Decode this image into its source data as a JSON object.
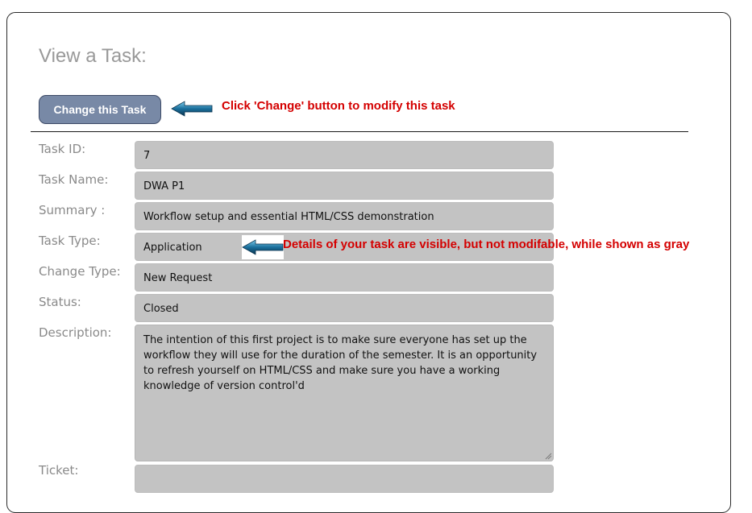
{
  "page": {
    "title": "View a Task:"
  },
  "toolbar": {
    "change_button_label": "Change this Task",
    "change_hint": "Click 'Change' button to modify this task"
  },
  "fields": {
    "task_id": {
      "label": "Task ID:",
      "value": "7"
    },
    "task_name": {
      "label": "Task Name:",
      "value": "DWA P1"
    },
    "summary": {
      "label": "Summary :",
      "value": "Workflow setup and essential HTML/CSS demonstration"
    },
    "task_type": {
      "label": "Task Type:",
      "value": "Application"
    },
    "change_type": {
      "label": "Change Type:",
      "value": "New Request"
    },
    "status": {
      "label": "Status:",
      "value": "Closed"
    },
    "description": {
      "label": "Description:",
      "value": "The intention of this first project is to make sure everyone has set up the workflow they will use for the duration of the semester. It is an opportunity to refresh yourself on HTML/CSS and make sure you have a working knowledge of version control'd"
    },
    "ticket": {
      "label": "Ticket:",
      "value": ""
    }
  },
  "annotations": {
    "readonly_hint": "Details of your task are visible, but not modifable, while shown as gray"
  },
  "colors": {
    "annotation_red": "#d40000",
    "button_bg": "#7889a6",
    "field_gray": "#c3c3c3",
    "label_gray": "#8a8a8a",
    "arrow_blue": "#1a6f9c"
  },
  "icons": {
    "hint_arrow": "left-arrow-icon"
  }
}
